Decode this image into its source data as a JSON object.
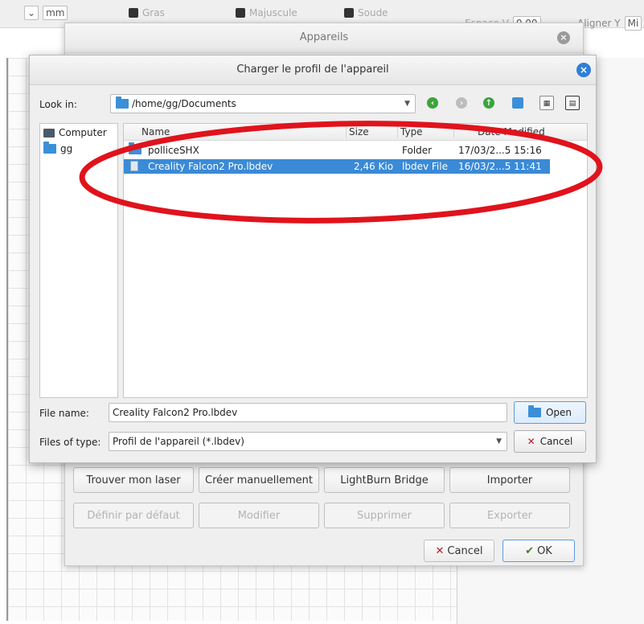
{
  "toolbar": {
    "unit": "mm",
    "bold": "Gras",
    "uppercase": "Majuscule",
    "weld": "Soude",
    "spacing_label": "Espace V",
    "spacing_value": "0,00",
    "align_y": "Aligner Y",
    "align_value": "Mi"
  },
  "devices_dialog": {
    "title": "Appareils",
    "buttons_row1": [
      "Trouver mon laser",
      "Créer manuellement",
      "LightBurn Bridge",
      "Importer"
    ],
    "buttons_row2": [
      "Définir par défaut",
      "Modifier",
      "Supprimer",
      "Exporter"
    ],
    "cancel": "Cancel",
    "ok": "OK"
  },
  "load_dialog": {
    "title": "Charger le profil de l'appareil",
    "look_in_label": "Look in:",
    "look_in_path": "/home/gg/Documents",
    "sidebar": [
      "Computer",
      "gg"
    ],
    "columns": [
      "Name",
      "Size",
      "Type",
      "Date Modified"
    ],
    "files": [
      {
        "name": "polliceSHX",
        "size": "",
        "type": "Folder",
        "modified": "17/03/2...5 15:16"
      },
      {
        "name": "Creality Falcon2 Pro.lbdev",
        "size": "2,46 Kio",
        "type": "lbdev File",
        "modified": "16/03/2...5 11:41"
      }
    ],
    "file_name_label": "File name:",
    "file_name_value": "Creality Falcon2 Pro.lbdev",
    "file_type_label": "Files of type:",
    "file_type_value": "Profil de l'appareil (*.lbdev)",
    "open": "Open",
    "cancel": "Cancel"
  },
  "colors": {
    "selection": "#3a8ad6",
    "highlight_ellipse": "#e0131c",
    "close_button": "#2f7fd6"
  }
}
